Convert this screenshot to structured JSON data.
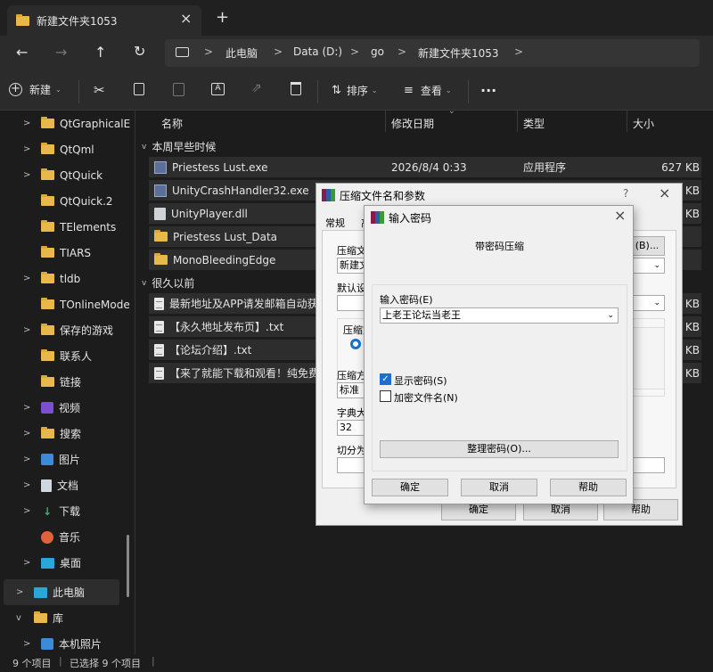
{
  "window": {
    "tab_title": "新建文件夹1053",
    "close_icon": "×",
    "new_tab_icon": "+"
  },
  "nav": {
    "back": "←",
    "forward": "→",
    "up": "↑",
    "refresh": "↻"
  },
  "address": {
    "crumbs": [
      "此电脑",
      "Data (D:)",
      "go",
      "新建文件夹1053"
    ],
    "sep": ">"
  },
  "toolbar": {
    "new_label": "新建",
    "sort_label": "排序",
    "view_label": "查看",
    "more": "..."
  },
  "sidebar": {
    "items": [
      {
        "label": "QtGraphicalE",
        "icon": "folder"
      },
      {
        "label": "QtQml",
        "icon": "folder"
      },
      {
        "label": "QtQuick",
        "icon": "folder"
      },
      {
        "label": "QtQuick.2",
        "icon": "folder"
      },
      {
        "label": "TElements",
        "icon": "folder"
      },
      {
        "label": "TIARS",
        "icon": "folder"
      },
      {
        "label": "tldb",
        "icon": "folder"
      },
      {
        "label": "TOnlineMode",
        "icon": "folder"
      },
      {
        "label": "保存的游戏",
        "icon": "folder"
      },
      {
        "label": "联系人",
        "icon": "folder"
      },
      {
        "label": "链接",
        "icon": "folder"
      },
      {
        "label": "视频",
        "icon": "video"
      },
      {
        "label": "搜索",
        "icon": "folder"
      },
      {
        "label": "图片",
        "icon": "picture"
      },
      {
        "label": "文档",
        "icon": "document"
      },
      {
        "label": "下载",
        "icon": "download"
      },
      {
        "label": "音乐",
        "icon": "music"
      },
      {
        "label": "桌面",
        "icon": "desktop"
      },
      {
        "label": "此电脑",
        "icon": "pc"
      },
      {
        "label": "库",
        "icon": "library"
      },
      {
        "label": "本机照片",
        "icon": "picture"
      }
    ]
  },
  "columns": {
    "name": "名称",
    "date": "修改日期",
    "type": "类型",
    "size": "大小"
  },
  "groups": {
    "this_week": "本周早些时候",
    "long_ago": "很久以前"
  },
  "files": [
    {
      "name": "Priestess Lust.exe",
      "date": "2026/8/4 0:33",
      "type": "应用程序",
      "size": "627 KB",
      "icon": "exe"
    },
    {
      "name": "UnityCrashHandler32.exe",
      "size": "KB",
      "icon": "exe"
    },
    {
      "name": "UnityPlayer.dll",
      "size": "KB",
      "icon": "gear-file"
    },
    {
      "name": "Priestess Lust_Data",
      "size": "",
      "icon": "folder"
    },
    {
      "name": "MonoBleedingEdge",
      "size": "",
      "icon": "folder"
    },
    {
      "name": "最新地址及APP请发邮箱自动获取",
      "size": "KB",
      "icon": "text-file"
    },
    {
      "name": "【永久地址发布页】.txt",
      "size": "KB",
      "icon": "text-file"
    },
    {
      "name": "【论坛介绍】.txt",
      "size": "KB",
      "icon": "text-file"
    },
    {
      "name": "【来了就能下载和观看！纯免费！",
      "size": "KB",
      "icon": "text-file"
    }
  ],
  "status": {
    "count": "9 个项目",
    "selected": "已选择 9 个项目"
  },
  "archive_dialog": {
    "title": "压缩文件名和参数",
    "help_q": "?",
    "tab_general": "常规",
    "tab_second": "高",
    "archive_name_label": "压缩文",
    "archive_name_value": "新建文",
    "browse_btn": "(B)...",
    "default_label": "默认设",
    "format_label": "压缩文",
    "method_label": "压缩方",
    "method_value": "标准",
    "dict_label": "字典大小",
    "dict_value": "32",
    "split_label": "切分为",
    "ok": "确定",
    "cancel": "取消",
    "help": "帮助"
  },
  "password_dialog": {
    "title": "输入密码",
    "subtitle": "带密码压缩",
    "enter_label": "输入密码(E)",
    "password_value": "上老王论坛当老王",
    "show_password": "显示密码(S)",
    "show_checked": true,
    "encrypt_names": "加密文件名(N)",
    "encrypt_checked": false,
    "organize_btn": "整理密码(O)...",
    "ok": "确定",
    "cancel": "取消",
    "help": "帮助"
  }
}
